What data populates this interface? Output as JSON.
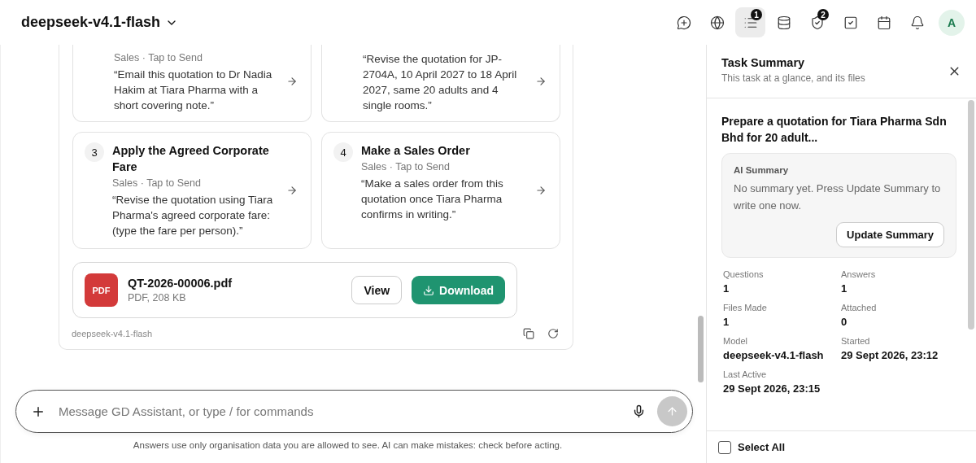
{
  "header": {
    "model": "deepseek-v4.1-flash",
    "tools": [
      {
        "kind": "new-chat",
        "selected": false
      },
      {
        "kind": "globe",
        "selected": false
      },
      {
        "kind": "list",
        "selected": true,
        "badge": "1"
      },
      {
        "kind": "database",
        "selected": false
      },
      {
        "kind": "shield",
        "selected": false,
        "badge": "2"
      },
      {
        "kind": "check",
        "selected": false
      },
      {
        "kind": "calendar",
        "selected": false
      },
      {
        "kind": "bell",
        "selected": false
      }
    ],
    "avatar": "A"
  },
  "suggestions": [
    {
      "kind": "cut",
      "category": "Sales · Tap to Send",
      "prompt": "“Email this quotation to Dr Nadia Hakim at Tiara Pharma with a short covering note.”"
    },
    {
      "kind": "cut",
      "prompt": "“Revise the quotation for JP-2704A, 10 April 2027 to 18 April 2027, same 20 adults and 4 single rooms.”"
    },
    {
      "kind": "full",
      "number": "3",
      "title": "Apply the Agreed Corporate Fare",
      "category": "Sales · Tap to Send",
      "prompt": "“Revise the quotation using Tiara Pharma's agreed corporate fare: (type the fare per person).”"
    },
    {
      "kind": "full",
      "number": "4",
      "title": "Make a Sales Order",
      "category": "Sales · Tap to Send",
      "prompt": "“Make a sales order from this quotation once Tiara Pharma confirms in writing.”"
    }
  ],
  "file": {
    "type_label": "PDF",
    "name": "QT-2026-00006.pdf",
    "meta": "PDF, 208 KB",
    "view": "View",
    "download": "Download"
  },
  "message_model": "deepseek-v4.1-flash",
  "composer": {
    "placeholder": "Message GD Assistant, or type / for commands",
    "disclaimer": "Answers use only organisation data you are allowed to see. AI can make mistakes: check before acting."
  },
  "task_summary": {
    "title": "Task Summary",
    "subtitle": "This task at a glance, and its files",
    "task": "Prepare a quotation for Tiara Pharma Sdn Bhd for 20 adult...",
    "ai_summary": {
      "heading": "AI Summary",
      "text": "No summary yet. Press Update Summary to write one now.",
      "button": "Update Summary"
    },
    "stats": [
      {
        "label": "Questions",
        "value": "1"
      },
      {
        "label": "Answers",
        "value": "1"
      },
      {
        "label": "Files Made",
        "value": "1"
      },
      {
        "label": "Attached",
        "value": "0"
      },
      {
        "label": "Model",
        "value": "deepseek-v4.1-flash"
      },
      {
        "label": "Started",
        "value": "29 Sept 2026, 23:12"
      },
      {
        "label": "Last Active",
        "value": "29 Sept 2026, 23:15"
      }
    ],
    "select_all": {
      "label": "Select All",
      "checked": false
    }
  }
}
